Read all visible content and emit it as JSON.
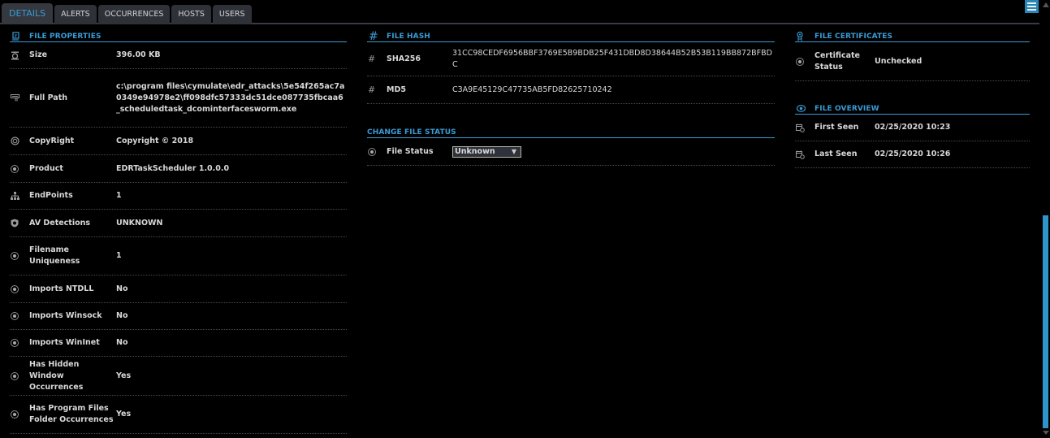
{
  "tabs": [
    {
      "label": "DETAILS",
      "active": true
    },
    {
      "label": "ALERTS",
      "active": false
    },
    {
      "label": "OCCURRENCES",
      "active": false
    },
    {
      "label": "HOSTS",
      "active": false
    },
    {
      "label": "USERS",
      "active": false
    }
  ],
  "toolbar": {
    "icon": "checklist-icon"
  },
  "file_properties": {
    "title": "FILE PROPERTIES",
    "rows": [
      {
        "label": "Size",
        "value": "396.00 KB",
        "icon": "weight-icon"
      },
      {
        "label": "Full Path",
        "value": "c:\\program files\\cymulate\\edr_attacks\\5e54f265ac7a0349e94978e2\\ff098dfc57333dc51dce087735fbcaa6_scheduledtask_dcominterfacesworm.exe",
        "icon": "path-icon"
      },
      {
        "label": "CopyRight",
        "value": "Copyright ©  2018",
        "icon": "copyright-icon"
      },
      {
        "label": "Product",
        "value": "EDRTaskScheduler 1.0.0.0",
        "icon": "radio-icon"
      },
      {
        "label": "EndPoints",
        "value": "1",
        "icon": "network-icon"
      },
      {
        "label": "AV Detections",
        "value": "UNKNOWN",
        "icon": "shield-icon"
      },
      {
        "label": "Filename Uniqueness",
        "value": "1",
        "icon": "radio-icon"
      },
      {
        "label": "Imports NTDLL",
        "value": "No",
        "icon": "radio-icon"
      },
      {
        "label": "Imports Winsock",
        "value": "No",
        "icon": "radio-icon"
      },
      {
        "label": "Imports WinInet",
        "value": "No",
        "icon": "radio-icon"
      },
      {
        "label": "Has Hidden Window Occurrences",
        "value": "Yes",
        "icon": "radio-icon"
      },
      {
        "label": "Has Program Files Folder Occurrences",
        "value": "Yes",
        "icon": "radio-icon"
      }
    ]
  },
  "file_hash": {
    "title": "FILE HASH",
    "rows": [
      {
        "label": "SHA256",
        "value": "31CC98CEDF6956BBF3769E5B9BDB25F431DBD8D38644B52B53B119BB872BFBDC"
      },
      {
        "label": "MD5",
        "value": "C3A9E45129C47735AB5FD82625710242"
      }
    ]
  },
  "change_file_status": {
    "title": "CHANGE FILE STATUS",
    "label": "File Status",
    "selected": "Unknown"
  },
  "file_certificates": {
    "title": "FILE CERTIFICATES",
    "rows": [
      {
        "label": "Certificate Status",
        "value": "Unchecked"
      }
    ]
  },
  "file_overview": {
    "title": "FILE OVERVIEW",
    "rows": [
      {
        "label": "First Seen",
        "value": "02/25/2020 10:23"
      },
      {
        "label": "Last Seen",
        "value": "02/25/2020 10:26"
      }
    ]
  }
}
